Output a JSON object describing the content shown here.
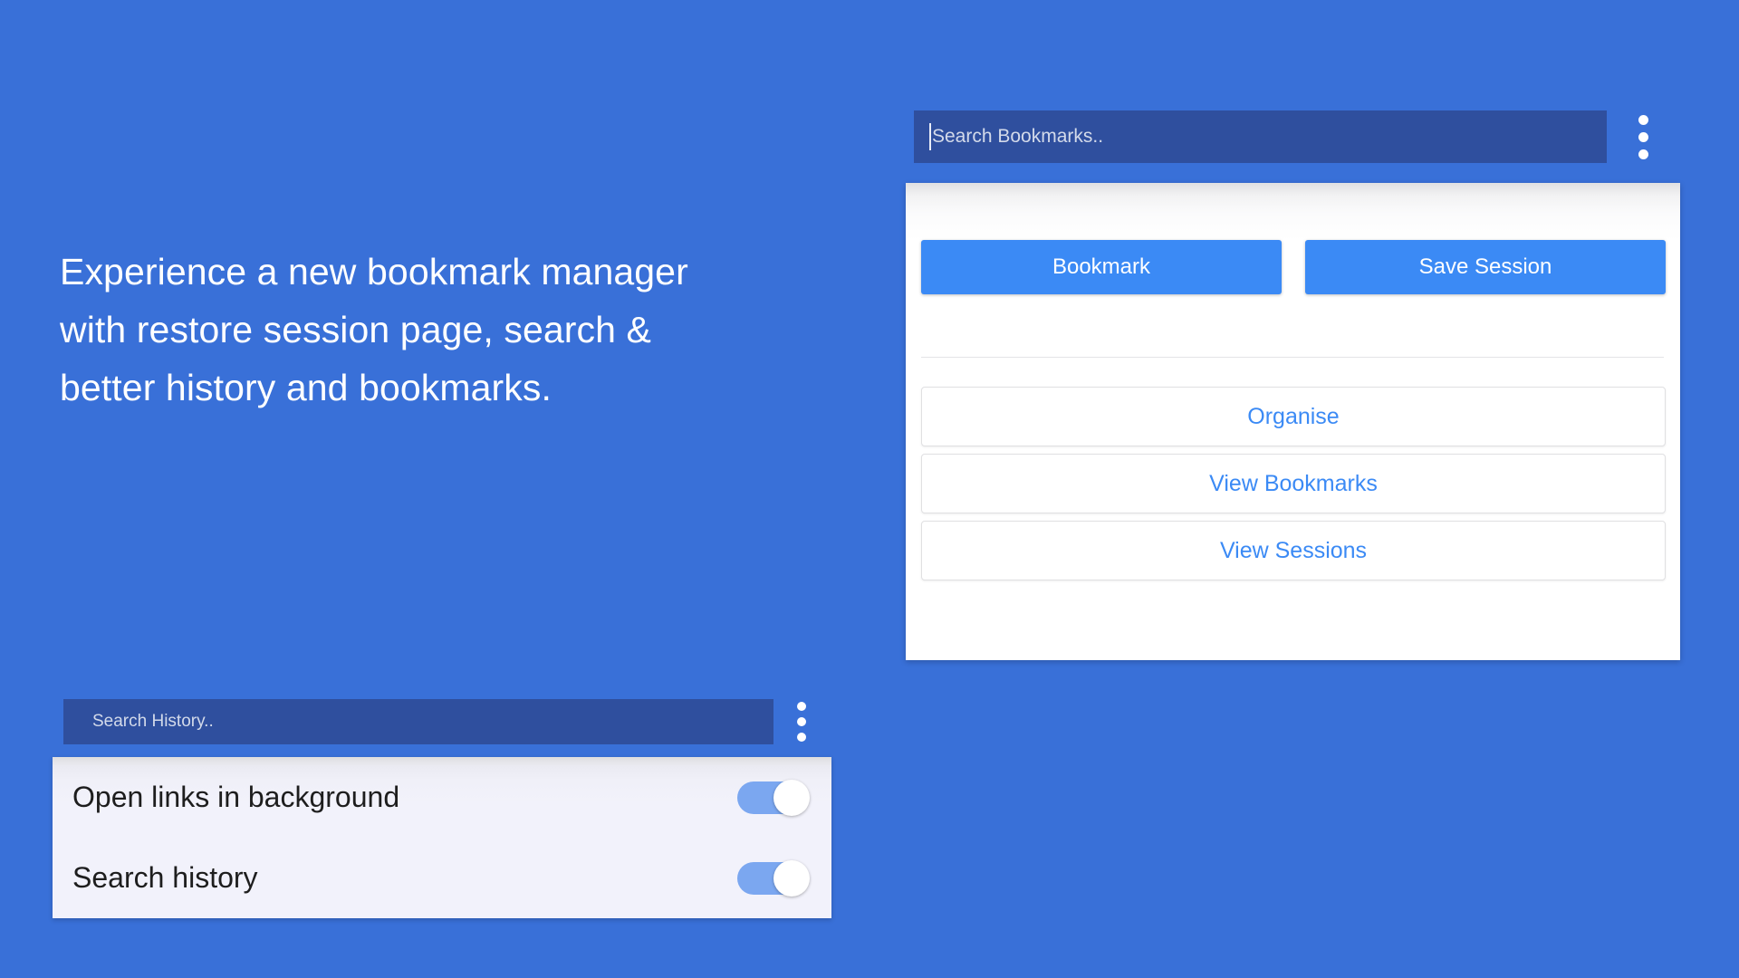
{
  "background_color": "#3970d8",
  "headline": {
    "text": "Experience a new bookmark manager\nwith restore session page, search &\nbetter history and bookmarks."
  },
  "bookmark_panel": {
    "search": {
      "placeholder": "Search Bookmarks..",
      "value": ""
    },
    "menu_icon": "kebab-menu-icon",
    "primary_actions": [
      {
        "label": "Bookmark"
      },
      {
        "label": "Save Session"
      }
    ],
    "link_actions": [
      {
        "label": "Organise"
      },
      {
        "label": "View Bookmarks"
      },
      {
        "label": "View Sessions"
      }
    ],
    "accent_color": "#3b8af5",
    "link_color": "#3b8af5",
    "search_field_color": "#2f4f9e"
  },
  "history_panel": {
    "search": {
      "placeholder": "Search History..",
      "value": ""
    },
    "menu_icon": "kebab-menu-icon",
    "settings": [
      {
        "label": "Open links in background",
        "state": "on"
      },
      {
        "label": "Search history",
        "state": "on"
      }
    ],
    "toggle_on_color": "#7ba7f0",
    "card_color": "#f2f2fb"
  }
}
